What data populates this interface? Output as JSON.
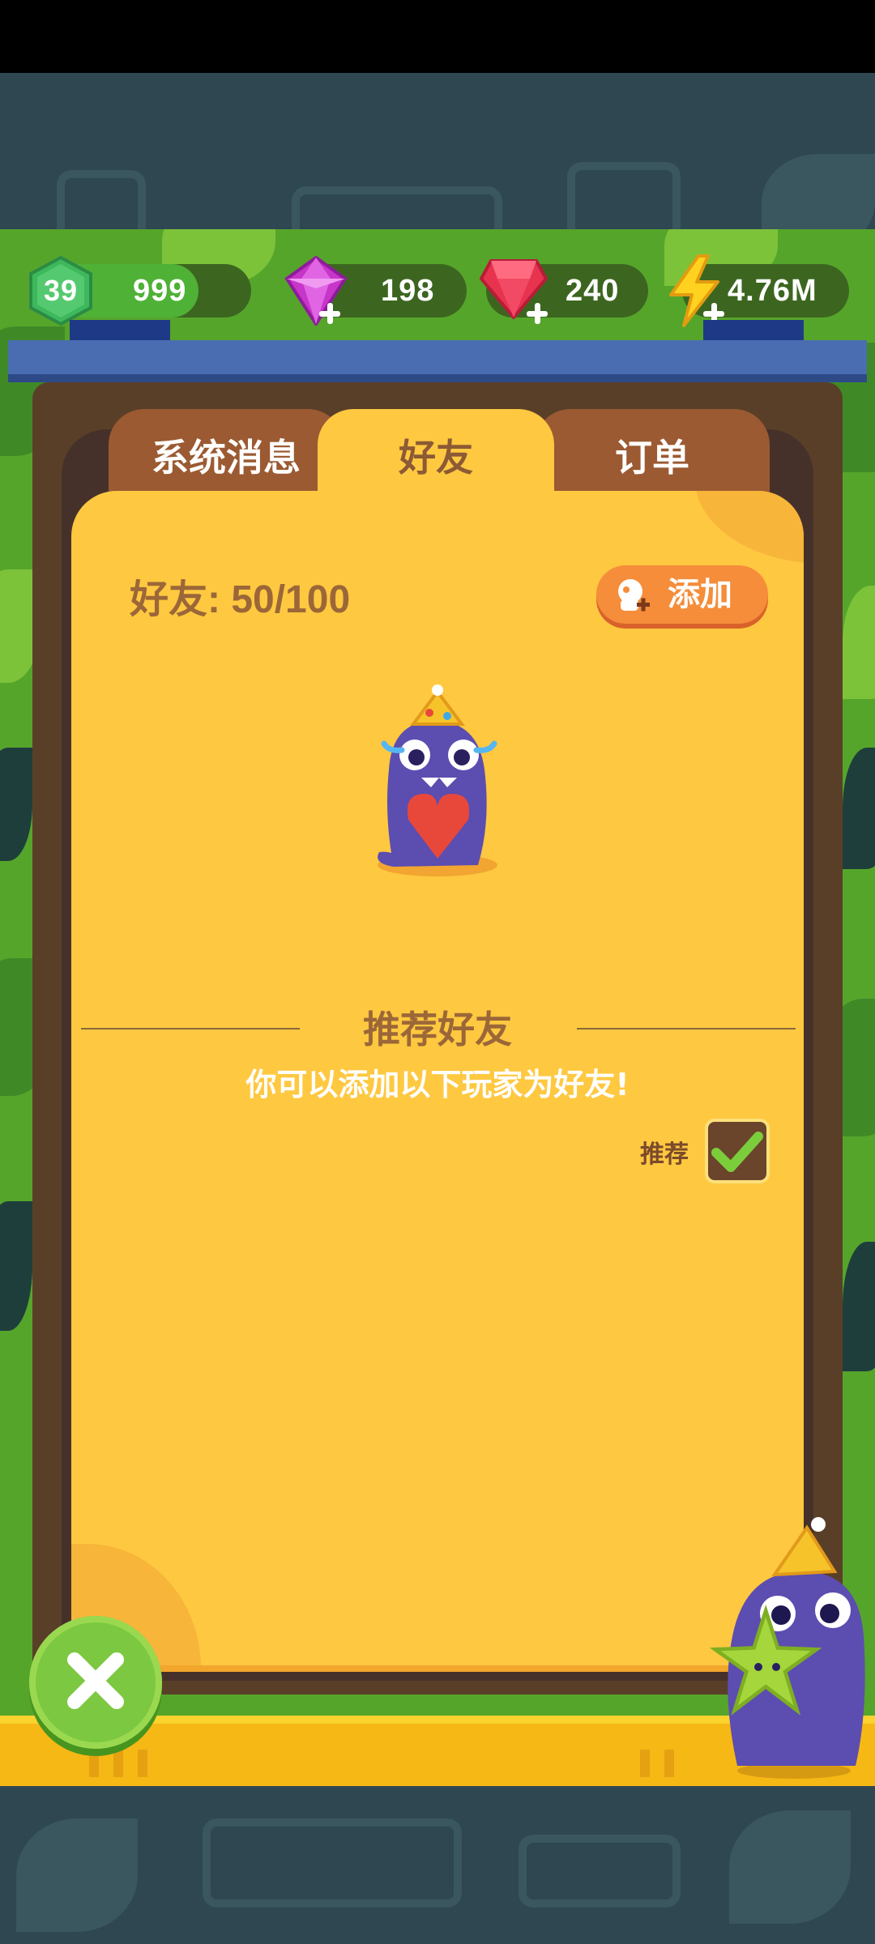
{
  "resources": {
    "level": "39",
    "xp": "999",
    "purple_gems": "198",
    "red_gems": "240",
    "energy": "4.76M"
  },
  "tabs": [
    {
      "label": "系统消息",
      "active": false
    },
    {
      "label": "好友",
      "active": true
    },
    {
      "label": "订单",
      "active": false
    }
  ],
  "friends": {
    "count_label": "好友: 50/100",
    "add_label": "添加"
  },
  "recommend": {
    "title": "推荐好友",
    "subtitle": "你可以添加以下玩家为好友!",
    "toggle_label": "推荐",
    "checked": true
  },
  "colors": {
    "panel": "#fec840",
    "tab_inactive": "#9b5a32",
    "add_button": "#f58d3a",
    "close_button": "#7cc841",
    "resource_pill": "#3c6620"
  },
  "icons": [
    "level-badge-icon",
    "purple-gem-icon",
    "red-gem-icon",
    "lightning-icon",
    "add-friend-icon",
    "checkmark-icon",
    "close-icon"
  ]
}
